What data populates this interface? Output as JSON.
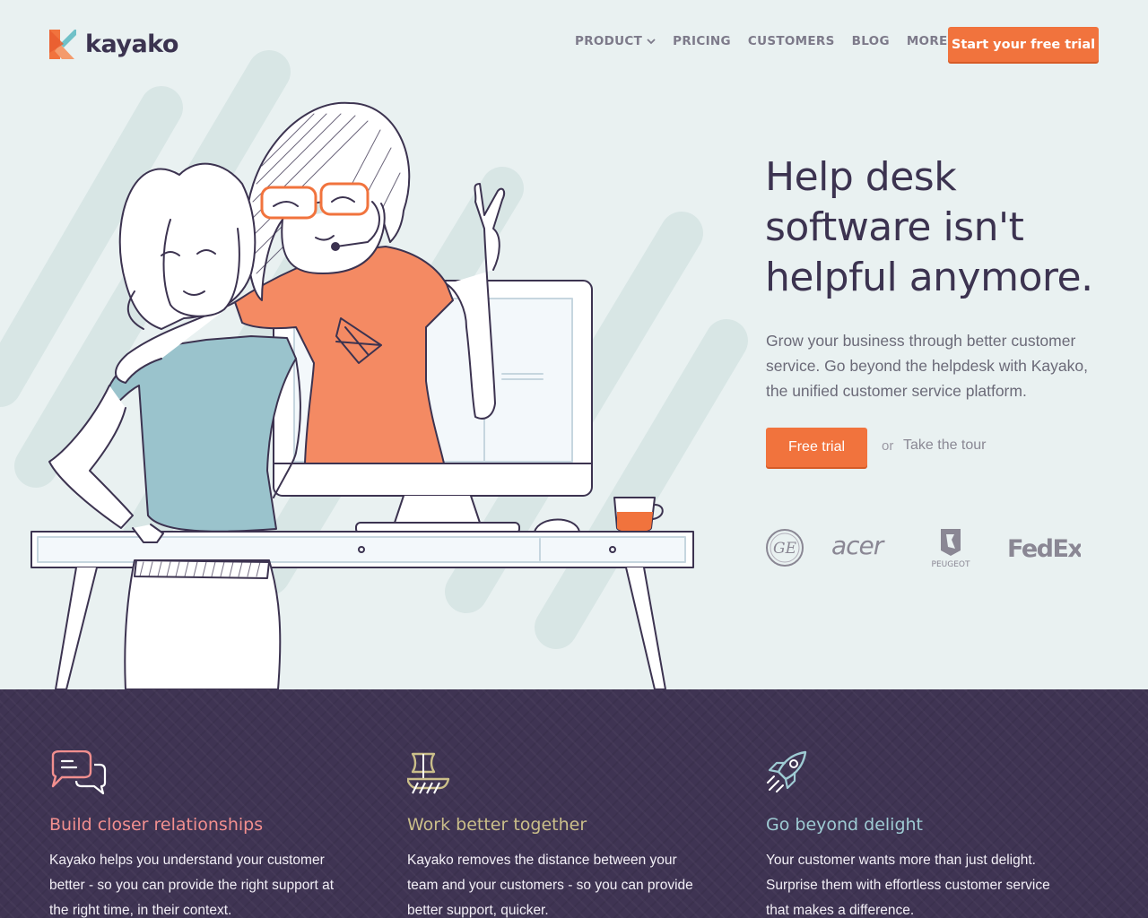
{
  "brand": {
    "name": "kayako",
    "accent": "#f1733d",
    "dark": "#3c3350"
  },
  "nav": {
    "items": [
      {
        "label": "PRODUCT",
        "has_dropdown": true
      },
      {
        "label": "PRICING",
        "has_dropdown": false
      },
      {
        "label": "CUSTOMERS",
        "has_dropdown": false
      },
      {
        "label": "BLOG",
        "has_dropdown": false
      },
      {
        "label": "MORE",
        "has_dropdown": true
      }
    ],
    "cta": "Start your free trial"
  },
  "hero": {
    "headline": "Help desk software isn't helpful anymore.",
    "subtext": "Grow your business through better customer service. Go beyond the helpdesk with Kayako, the unified customer service platform.",
    "primary_cta": "Free trial",
    "or": "or",
    "secondary_cta": "Take the tour",
    "illustration_icon": "two-women-at-desk-illustration"
  },
  "clients": [
    {
      "name": "GE",
      "icon": "ge-logo"
    },
    {
      "name": "acer",
      "icon": "acer-logo"
    },
    {
      "name": "PEUGEOT",
      "icon": "peugeot-logo"
    },
    {
      "name": "FedEx",
      "icon": "fedex-logo"
    }
  ],
  "features": [
    {
      "icon": "chat-bubbles-icon",
      "title": "Build closer relationships",
      "color": "#f28f8f",
      "text": "Kayako helps you understand your customer better - so you can provide the right support at the right time, in their context."
    },
    {
      "icon": "sailboat-icon",
      "title": "Work better together",
      "color": "#cbbf8a",
      "text": "Kayako removes the distance between your team and your customers - so you can provide better support, quicker."
    },
    {
      "icon": "rocket-icon",
      "title": "Go beyond delight",
      "color": "#9ecbd3",
      "text": "Your customer wants more than just delight. Surprise them with effortless customer service that makes a difference."
    }
  ]
}
